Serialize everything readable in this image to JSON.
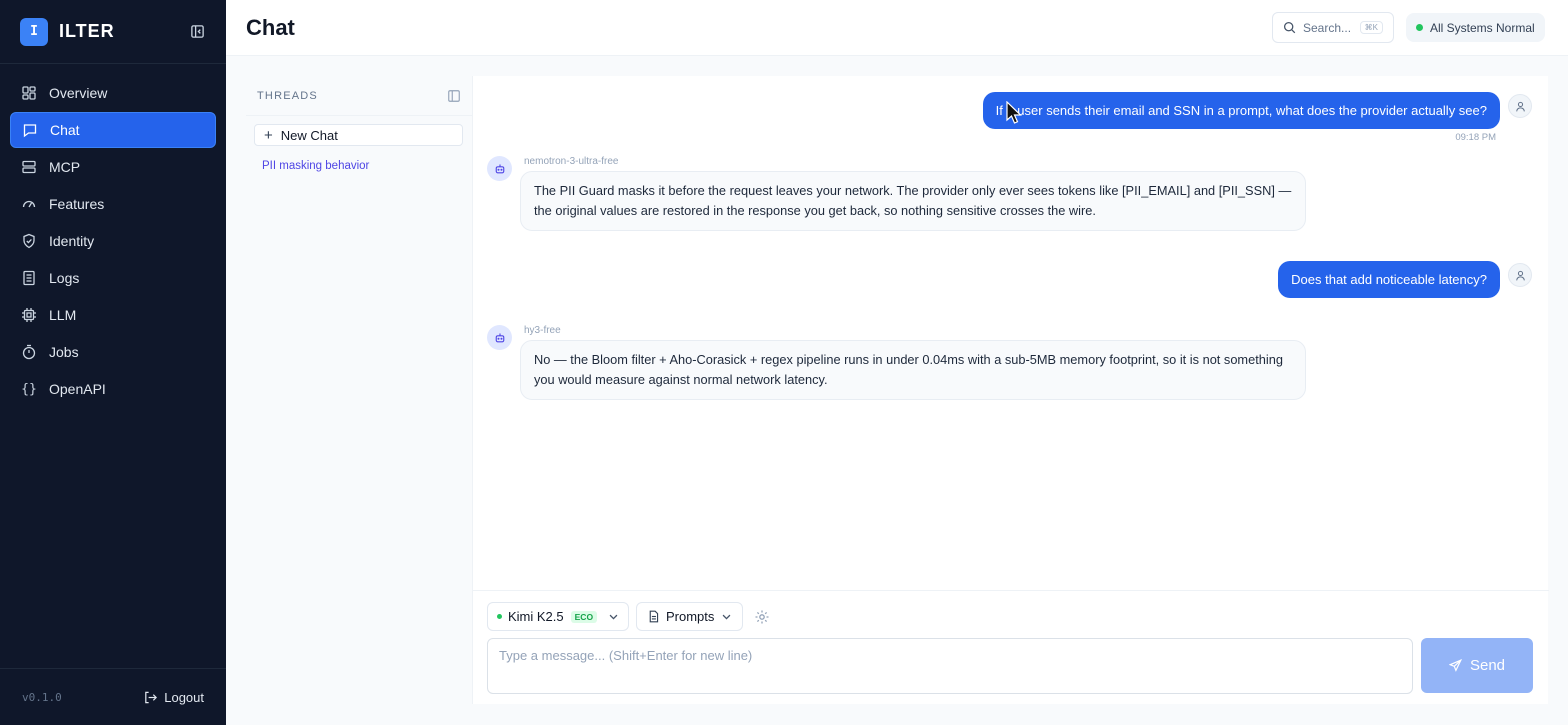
{
  "app": {
    "logo_letter": "I",
    "name": "ILTER",
    "version": "v0.1.0"
  },
  "sidebar": {
    "items": [
      {
        "label": "Overview",
        "icon": "grid-icon",
        "active": false
      },
      {
        "label": "Chat",
        "icon": "message-square-icon",
        "active": true
      },
      {
        "label": "MCP",
        "icon": "server-icon",
        "active": false
      },
      {
        "label": "Features",
        "icon": "gauge-icon",
        "active": false
      },
      {
        "label": "Identity",
        "icon": "shield-icon",
        "active": false
      },
      {
        "label": "Logs",
        "icon": "log-book-icon",
        "active": false
      },
      {
        "label": "LLM",
        "icon": "cpu-icon",
        "active": false
      },
      {
        "label": "Jobs",
        "icon": "timer-icon",
        "active": false
      },
      {
        "label": "OpenAPI",
        "icon": "braces-icon",
        "active": false
      }
    ],
    "logout_label": "Logout"
  },
  "header": {
    "title": "Chat",
    "search_placeholder": "Search...",
    "search_shortcut": "⌘K",
    "status": "All Systems Normal",
    "status_color": "#22c55e"
  },
  "threads": {
    "title": "THREADS",
    "new_chat_label": "New Chat",
    "items": [
      "PII masking behavior"
    ]
  },
  "chat": {
    "messages": [
      {
        "role": "user",
        "text": "If a user sends their email and SSN in a prompt, what does the provider actually see?",
        "time": "09:18 PM"
      },
      {
        "role": "assistant",
        "model": "nemotron-3-ultra-free",
        "text": "The PII Guard masks it before the request leaves your network. The provider only ever sees tokens like [PII_EMAIL] and [PII_SSN] — the original values are restored in the response you get back, so nothing sensitive crosses the wire."
      },
      {
        "role": "user",
        "text": "Does that add noticeable latency?"
      },
      {
        "role": "assistant",
        "model": "hy3-free",
        "text": "No — the Bloom filter + Aho-Corasick + regex pipeline runs in under 0.04ms with a sub-5MB memory footprint, so it is not something you would measure against normal network latency."
      }
    ]
  },
  "composer": {
    "model": "Kimi K2.5",
    "model_badge": "ECO",
    "prompts_label": "Prompts",
    "input_placeholder": "Type a message... (Shift+Enter for new line)",
    "send_label": "Send"
  },
  "colors": {
    "accent": "#2563eb",
    "sidebar_bg": "#0f172a",
    "send_disabled": "#93b4f7"
  }
}
